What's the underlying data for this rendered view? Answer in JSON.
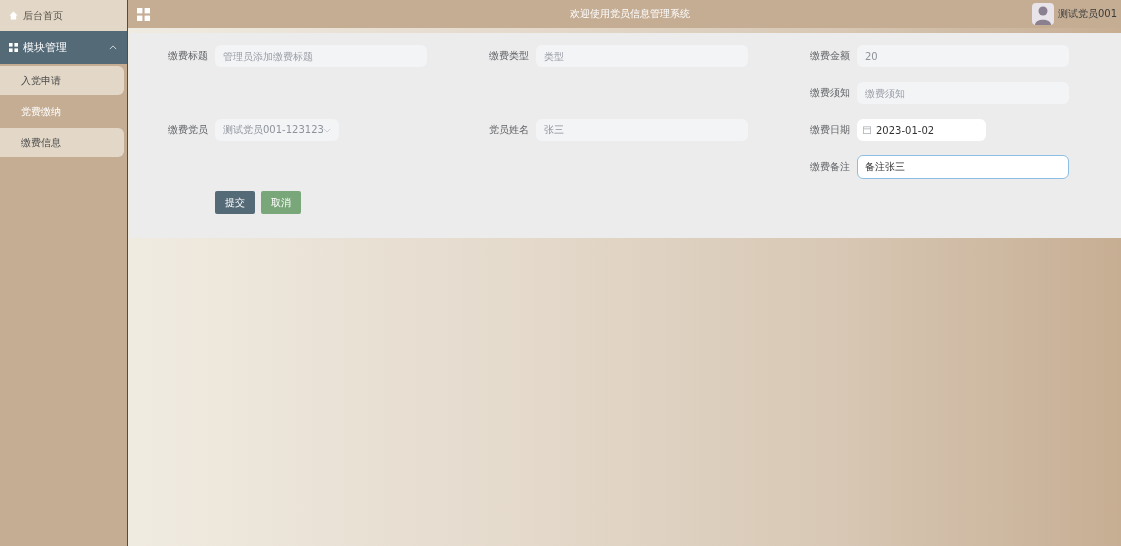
{
  "sidebar": {
    "home": {
      "label": "后台首页"
    },
    "group": {
      "label": "模块管理",
      "expanded": true
    },
    "items": [
      {
        "label": "入党申请",
        "selected": false
      },
      {
        "label": "党费缴纳",
        "selected": true
      },
      {
        "label": "缴费信息",
        "selected": false
      }
    ]
  },
  "header": {
    "title": "欢迎使用党员信息管理系统",
    "user": "测试党员001"
  },
  "form": {
    "rows": [
      {
        "left": {
          "label": "缴费标题",
          "kind": "input",
          "placeholder": "管理员添加缴费标题",
          "disabled": true,
          "focused": false
        },
        "middle": {
          "label": "缴费类型",
          "kind": "input",
          "placeholder": "类型",
          "disabled": true,
          "focused": false
        },
        "right": {
          "label": "缴费金额",
          "kind": "input",
          "value": "20",
          "disabled": true,
          "focused": false
        }
      },
      {
        "right": {
          "label": "缴费须知",
          "kind": "input",
          "placeholder": "缴费须知",
          "disabled": true,
          "focused": false
        }
      },
      {
        "left": {
          "label": "缴费党员",
          "kind": "select",
          "value": "测试党员001-123123",
          "disabled": true,
          "focused": false
        },
        "middle": {
          "label": "党员姓名",
          "kind": "input",
          "value": "张三",
          "disabled": true,
          "focused": false
        },
        "right": {
          "label": "缴费日期",
          "kind": "date",
          "value": "2023-01-02",
          "disabled": false,
          "focused": false
        }
      },
      {
        "right": {
          "label": "缴费备注",
          "kind": "input",
          "value": "备注张三",
          "disabled": false,
          "focused": true
        }
      }
    ],
    "buttons": [
      {
        "label": "提交",
        "kind": "primary"
      },
      {
        "label": "取消",
        "kind": "secondary"
      }
    ]
  }
}
